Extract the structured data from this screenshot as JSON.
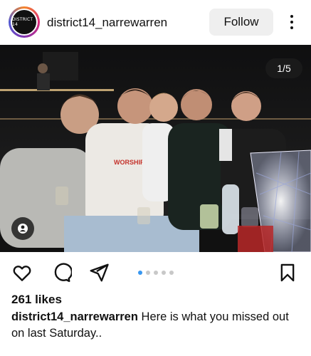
{
  "header": {
    "avatar_text": "DISTRICT 14",
    "username": "district14_narrewarren",
    "follow_label": "Follow"
  },
  "photo": {
    "counter": "1/5",
    "shirt_print": "WORSHIP"
  },
  "actions": {
    "carousel_total": 5,
    "carousel_active": 1
  },
  "post": {
    "likes": "261 likes",
    "caption_user": "district14_narrewarren",
    "caption_text": " Here is what you missed out on last Saturday.."
  },
  "colors": {
    "accent": "#3897f0",
    "follow_bg": "#efefef"
  }
}
